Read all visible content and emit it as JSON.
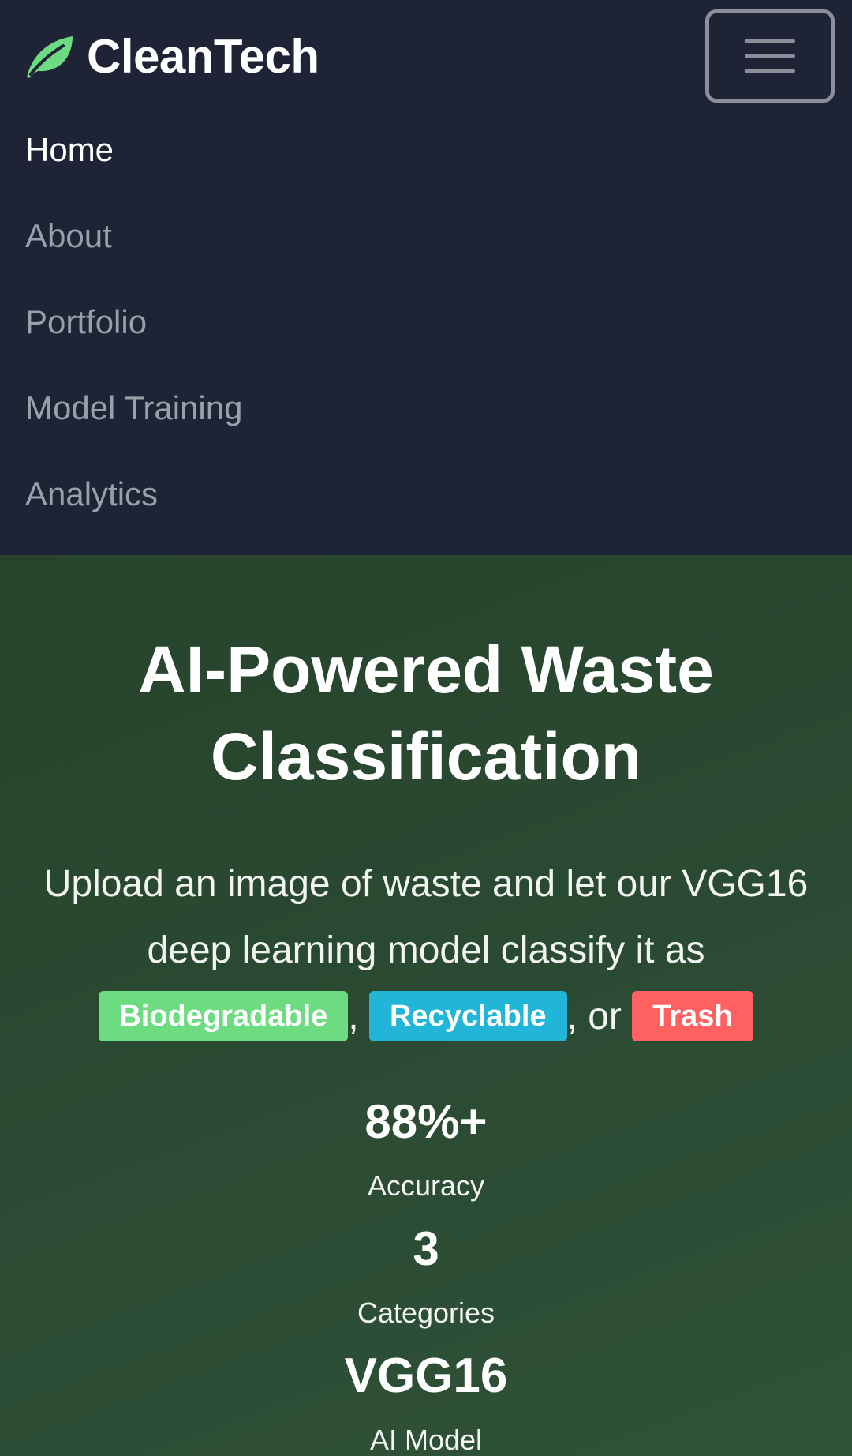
{
  "brand": {
    "name": "CleanTech",
    "logo_icon": "leaf-icon",
    "accent": "#6ddc80"
  },
  "nav": {
    "toggle_icon": "hamburger-icon",
    "items": [
      {
        "label": "Home",
        "active": true
      },
      {
        "label": "About",
        "active": false
      },
      {
        "label": "Portfolio",
        "active": false
      },
      {
        "label": "Model Training",
        "active": false
      },
      {
        "label": "Analytics",
        "active": false
      }
    ]
  },
  "hero": {
    "title": "AI-Powered Waste Classification",
    "lead_text": "Upload an image of waste and let our VGG16 deep learning model classify it as",
    "separator_1": ",",
    "separator_2": ", or",
    "categories": [
      {
        "label": "Biodegradable",
        "color": "#6ddc80"
      },
      {
        "label": "Recyclable",
        "color": "#21b6d8"
      },
      {
        "label": "Trash",
        "color": "#ff6060"
      }
    ]
  },
  "stats": [
    {
      "value": "88%+",
      "label": "Accuracy"
    },
    {
      "value": "3",
      "label": "Categories"
    },
    {
      "value": "VGG16",
      "label": "AI Model"
    }
  ]
}
